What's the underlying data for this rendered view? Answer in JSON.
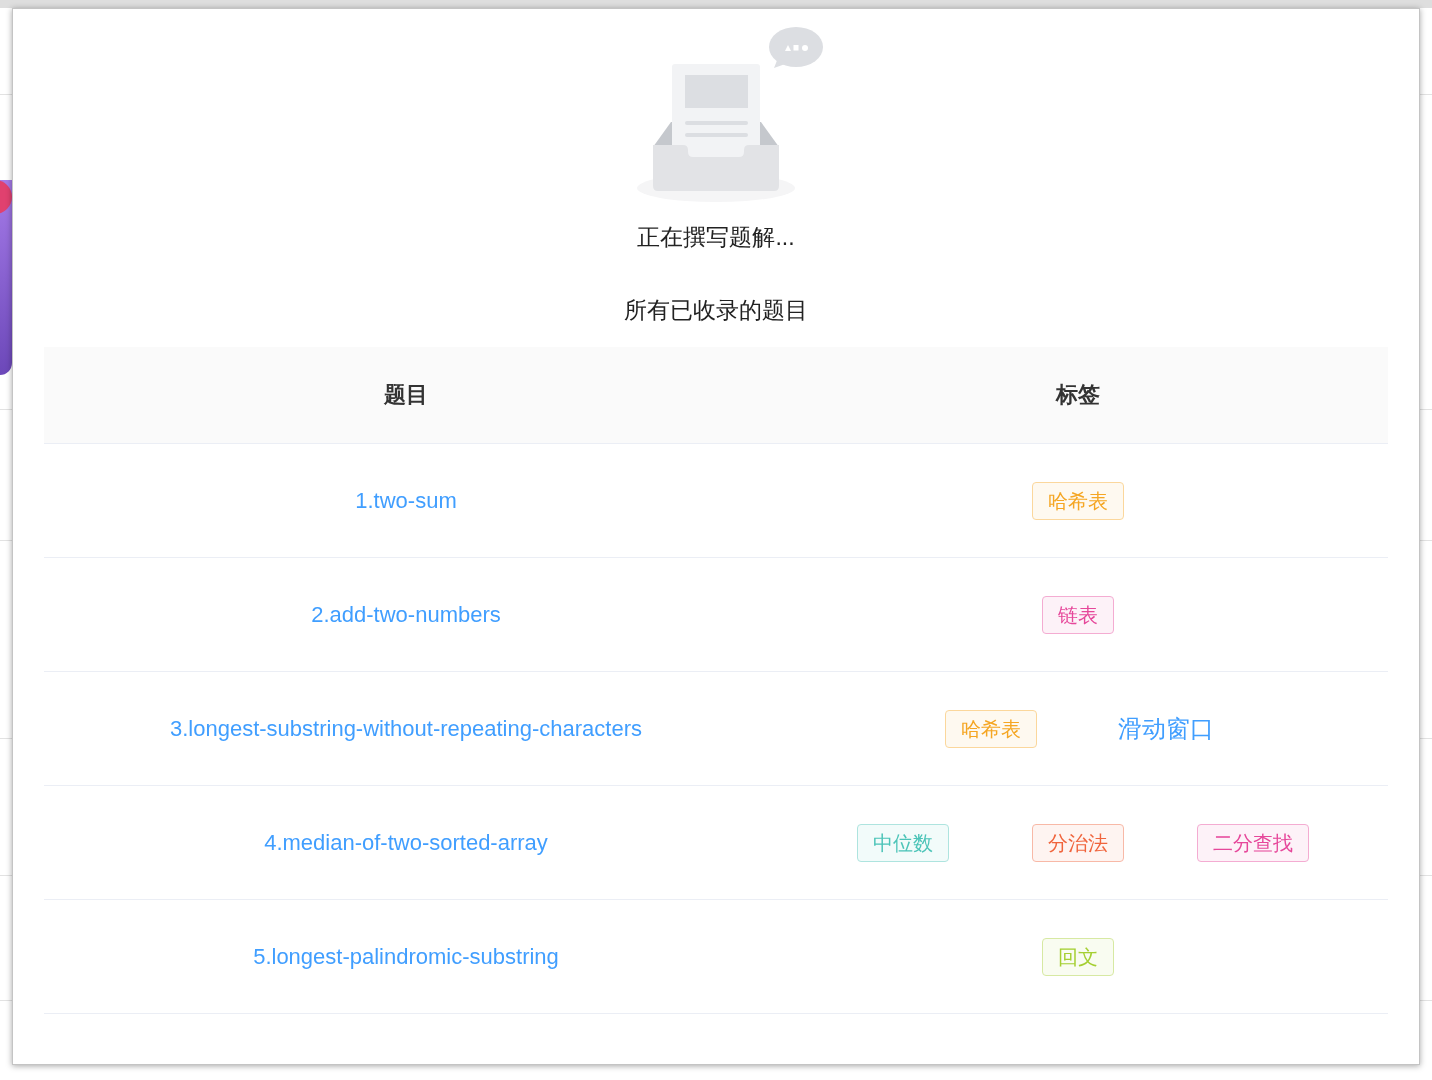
{
  "empty_state": {
    "message": "正在撰写题解..."
  },
  "section_title": "所有已收录的题目",
  "table": {
    "columns": [
      "题目",
      "标签"
    ],
    "rows": [
      {
        "title": "1.two-sum",
        "tags": [
          {
            "label": "哈希表",
            "kind": "tag",
            "color": "#f5a623"
          }
        ]
      },
      {
        "title": "2.add-two-numbers",
        "tags": [
          {
            "label": "链表",
            "kind": "tag",
            "color": "#e6479a"
          }
        ]
      },
      {
        "title": "3.longest-substring-without-repeating-characters",
        "tags": [
          {
            "label": "哈希表",
            "kind": "tag",
            "color": "#f5a623"
          },
          {
            "label": "滑动窗口",
            "kind": "plain",
            "color": "#409eff"
          }
        ]
      },
      {
        "title": "4.median-of-two-sorted-array",
        "tags": [
          {
            "label": "中位数",
            "kind": "tag",
            "color": "#4cc4b8"
          },
          {
            "label": "分治法",
            "kind": "tag",
            "color": "#f0643c"
          },
          {
            "label": "二分查找",
            "kind": "tag",
            "color": "#e6479a"
          }
        ]
      },
      {
        "title": "5.longest-palindromic-substring",
        "tags": [
          {
            "label": "回文",
            "kind": "tag",
            "color": "#a5cf32"
          }
        ]
      }
    ]
  }
}
